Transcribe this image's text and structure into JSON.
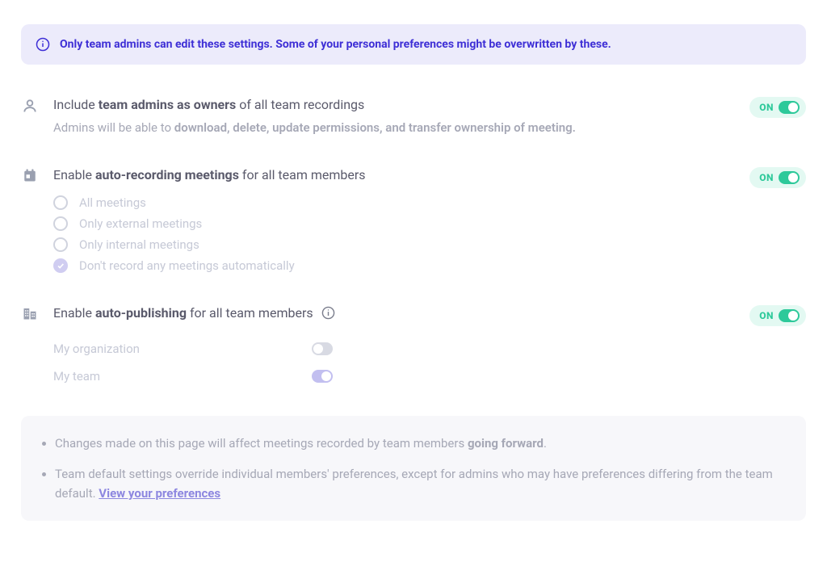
{
  "banner": {
    "text": "Only team admins can edit these settings. Some of your personal preferences might be overwritten by these."
  },
  "settings": {
    "admins_owners": {
      "title_prefix": "Include ",
      "title_bold": "team admins as owners",
      "title_suffix": " of all team recordings",
      "desc_prefix": "Admins will be able to ",
      "desc_bold": "download, delete, update permissions, and transfer ownership of meeting.",
      "toggle_label": "ON"
    },
    "auto_recording": {
      "title_prefix": "Enable ",
      "title_bold": "auto-recording meetings",
      "title_suffix": " for all team members",
      "toggle_label": "ON",
      "options": [
        {
          "label": "All meetings",
          "selected": false
        },
        {
          "label": "Only external meetings",
          "selected": false
        },
        {
          "label": "Only internal meetings",
          "selected": false
        },
        {
          "label": "Don't record any meetings automatically",
          "selected": true
        }
      ]
    },
    "auto_publishing": {
      "title_prefix": "Enable ",
      "title_bold": "auto-publishing",
      "title_suffix": " for all team members",
      "toggle_label": "ON",
      "subs": [
        {
          "label": "My organization",
          "state": "off"
        },
        {
          "label": "My team",
          "state": "on-disabled"
        }
      ]
    }
  },
  "footer": {
    "note1_prefix": "Changes made on this page will affect meetings recorded by team members ",
    "note1_bold": "going forward",
    "note1_suffix": ".",
    "note2_text": "Team default settings override individual members' preferences, except for admins who may have preferences differing from the team default. ",
    "note2_link": "View your preferences"
  }
}
